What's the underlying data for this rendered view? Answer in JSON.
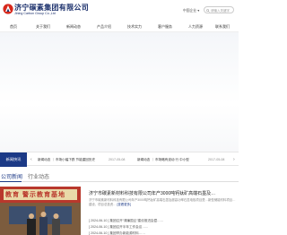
{
  "header": {
    "company_cn": "济宁碳素集团有限公司",
    "company_en": "Jining Carbon Group Co.,Ltd",
    "language": "中国企业 ▾",
    "search_placeholder": "请输入关键字"
  },
  "nav": {
    "items": [
      "首页",
      "关于我们",
      "新闻动态",
      "产品介绍",
      "技术实力",
      "客户服务",
      "人力资源",
      "联系我们"
    ]
  },
  "ticker": {
    "label": "新闻快讯",
    "items": [
      {
        "title": "新闻动态 ｜ 市场小幅下跌 节能重回历史",
        "date": "2017-05-08"
      },
      {
        "title": "新闻动态 ｜ 市场略有波动 行 中小型",
        "date": "2017-05-08"
      }
    ]
  },
  "tabs": {
    "active": "公司新闻",
    "inactive": "行业动态"
  },
  "news": {
    "photo_caption": "教育 警示教育基地",
    "headline": "济宁市碳素新材料科技有限公司年产3000吨钙钛矿高端石墨及…",
    "summary": "济宁市碳素新材料科技有限公司年产3000吨钙钛矿高端石墨及超高功率石墨电极项目是…新型储能材料项目…建设，项目总投资…",
    "more": "[查看更多]",
    "list": [
      {
        "date": "[ 2024-06-10 ]",
        "title": "集团召开“清廉国企”建设推进会暨……"
      },
      {
        "date": "[ 2024-06-10 ]",
        "title": "集团召开半年工作会议……"
      },
      {
        "date": "[ 2024-06-10 ]",
        "title": "集团举办新能源材料……"
      }
    ]
  },
  "colors": {
    "brand_blue": "#1c3a86",
    "logo_red": "#d6281c"
  }
}
